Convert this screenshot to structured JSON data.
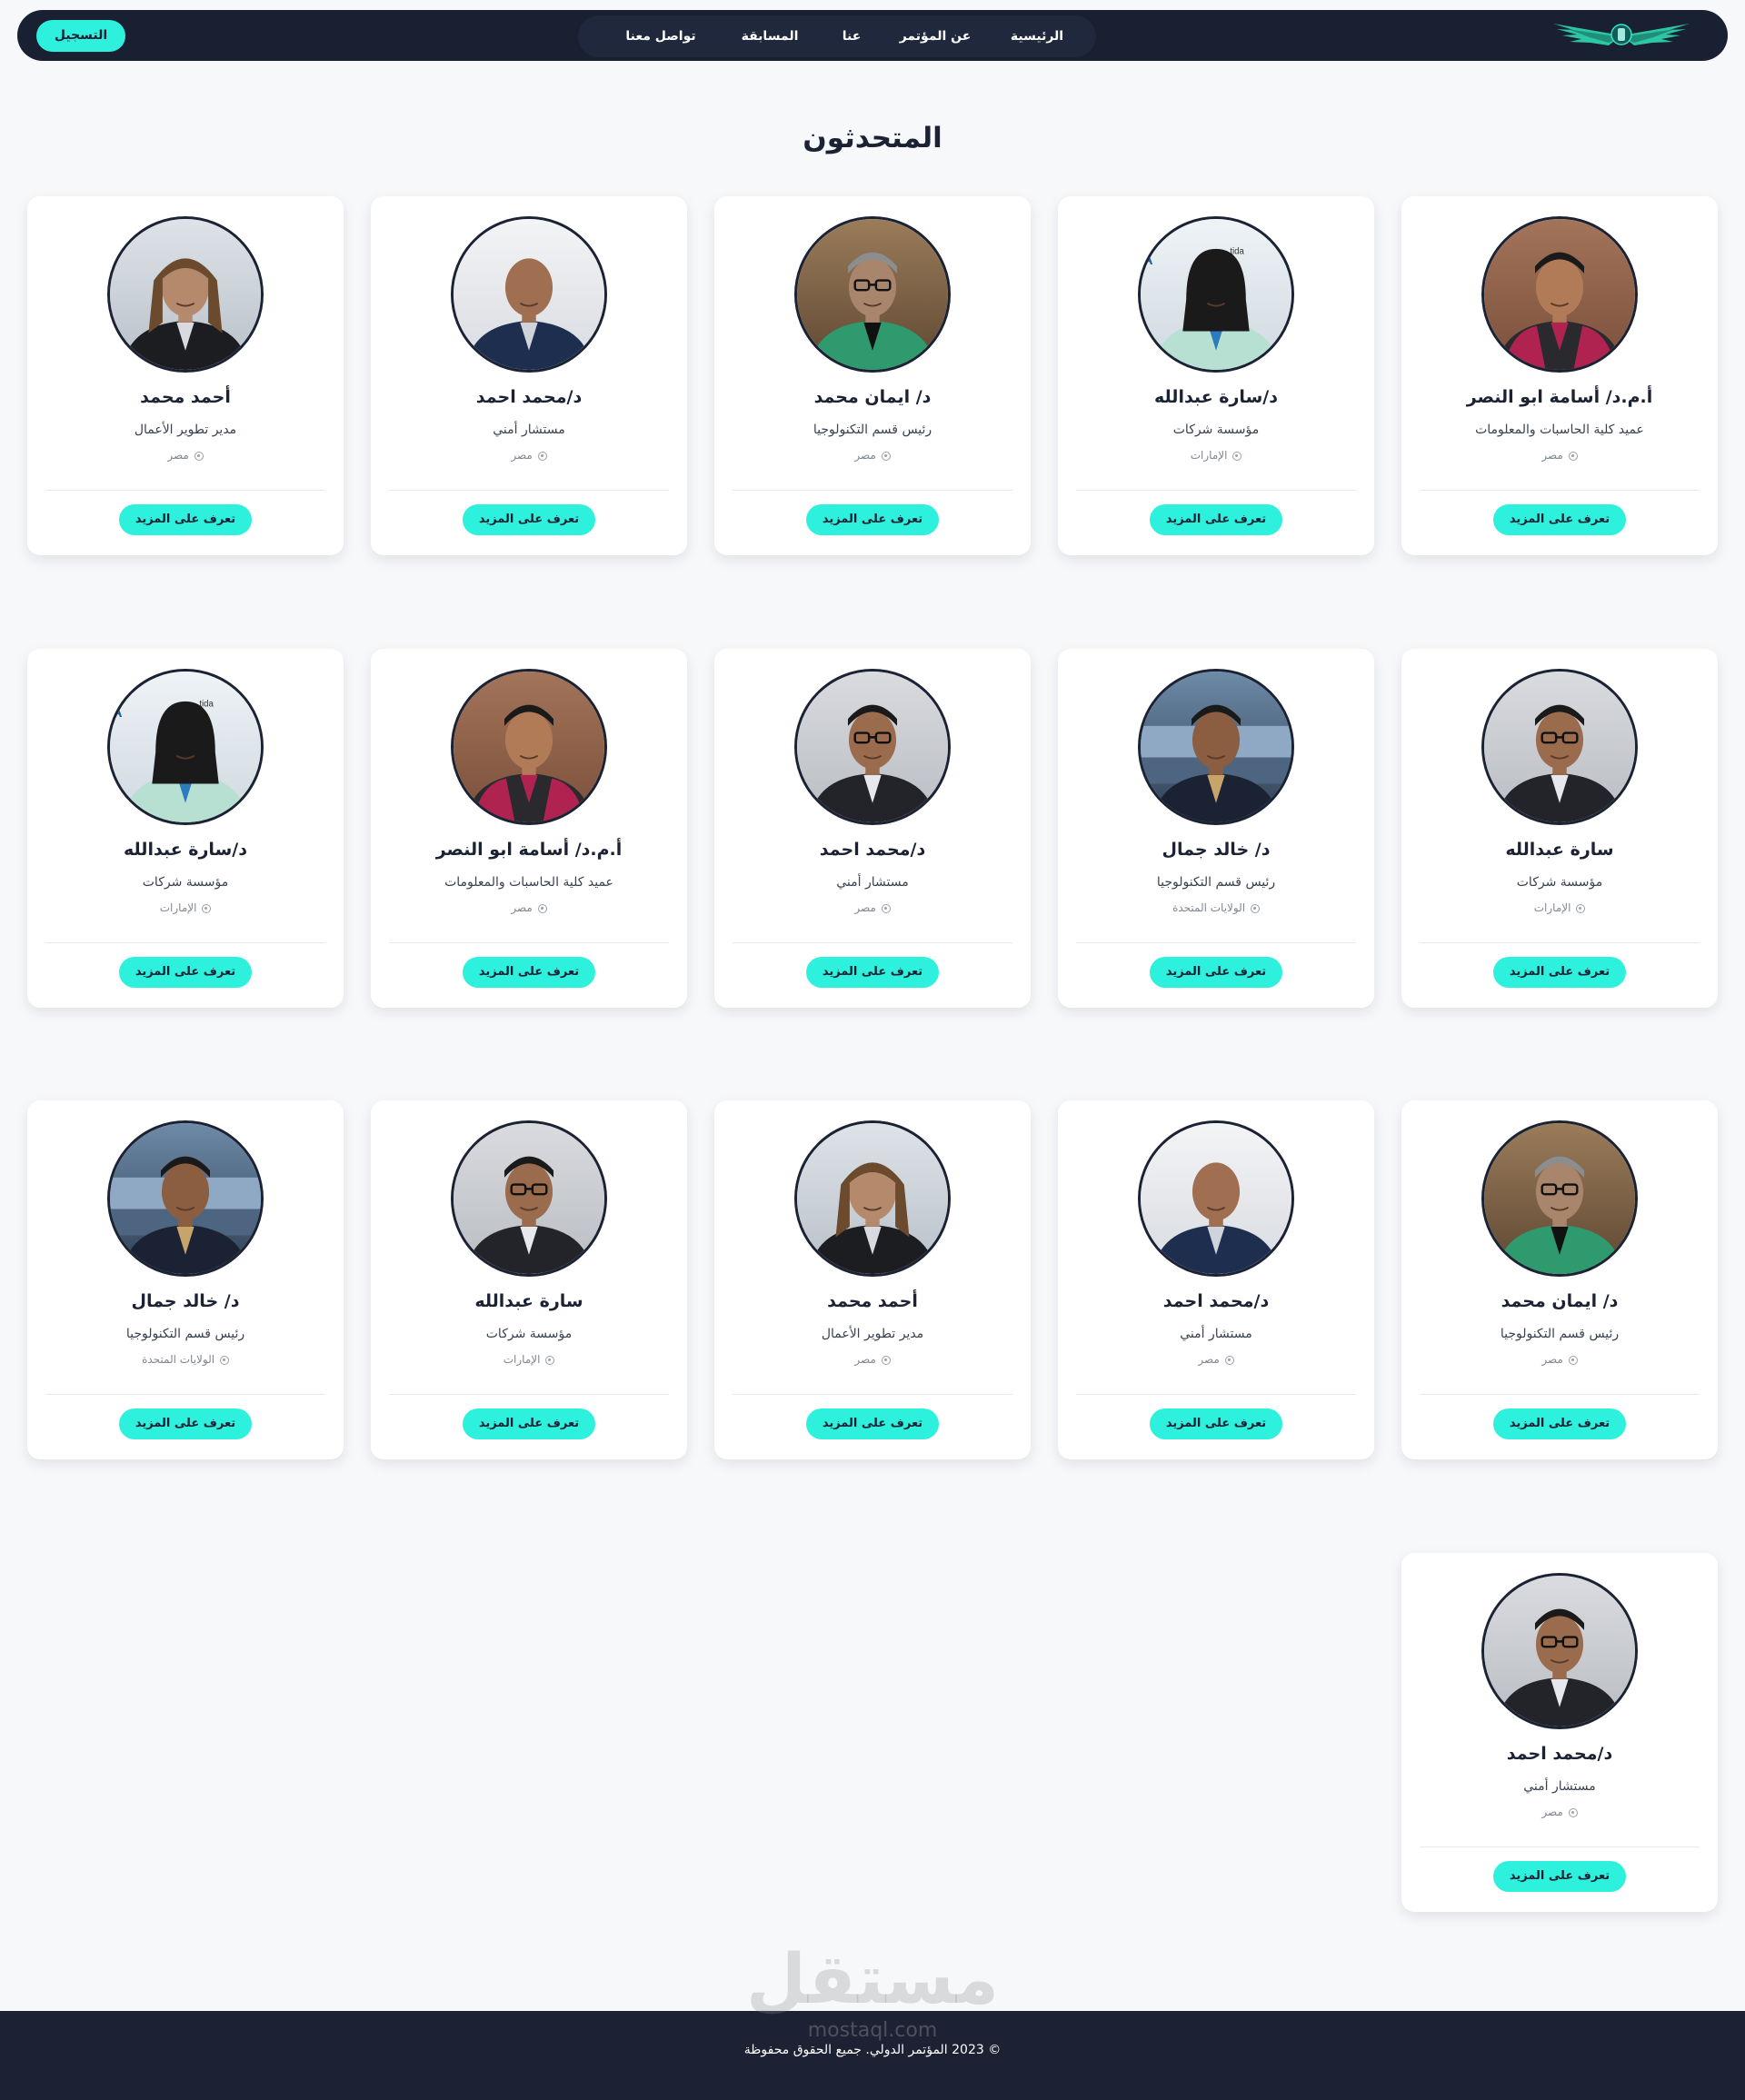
{
  "nav": {
    "links": [
      "الرئيسية",
      "عن المؤتمر",
      "عنا",
      "المسابقة",
      "تواصل معنا"
    ],
    "register_label": "التسجيل"
  },
  "page_title": "المتحدثون",
  "more_label": "تعرف على المزيد",
  "speakers": [
    {
      "name": "أ.م.د/ أسامة ابو النصر",
      "role": "عميد كلية الحاسبات والمعلومات",
      "country": "مصر",
      "photo": "gown"
    },
    {
      "name": "د/سارة عبدالله",
      "role": "مؤسسة شركات",
      "country": "الإمارات",
      "photo": "hijab-mint"
    },
    {
      "name": "د/ ايمان محمد",
      "role": "رئيس قسم التكنولوجيا",
      "country": "مصر",
      "photo": "glasses-green"
    },
    {
      "name": "د/محمد احمد",
      "role": "مستشار أمني",
      "country": "مصر",
      "photo": "bald-suit"
    },
    {
      "name": "أحمد محمد",
      "role": "مدير تطوير الأعمال",
      "country": "مصر",
      "photo": "long-hair"
    },
    {
      "name": "سارة عبدالله",
      "role": "مؤسسة شركات",
      "country": "الإمارات",
      "photo": "glasses-suit"
    },
    {
      "name": "د/ خالد جمال",
      "role": "رئيس قسم التكنولوجيا",
      "country": "الولايات المتحدة",
      "photo": "river"
    },
    {
      "name": "د/محمد احمد",
      "role": "مستشار أمني",
      "country": "مصر",
      "photo": "glasses-suit"
    },
    {
      "name": "أ.م.د/ أسامة ابو النصر",
      "role": "عميد كلية الحاسبات والمعلومات",
      "country": "مصر",
      "photo": "gown"
    },
    {
      "name": "د/سارة عبدالله",
      "role": "مؤسسة شركات",
      "country": "الإمارات",
      "photo": "hijab-mint"
    },
    {
      "name": "د/ ايمان محمد",
      "role": "رئيس قسم التكنولوجيا",
      "country": "مصر",
      "photo": "glasses-green"
    },
    {
      "name": "د/محمد احمد",
      "role": "مستشار أمني",
      "country": "مصر",
      "photo": "bald-suit"
    },
    {
      "name": "أحمد محمد",
      "role": "مدير تطوير الأعمال",
      "country": "مصر",
      "photo": "long-hair"
    },
    {
      "name": "سارة عبدالله",
      "role": "مؤسسة شركات",
      "country": "الإمارات",
      "photo": "glasses-suit"
    },
    {
      "name": "د/ خالد جمال",
      "role": "رئيس قسم التكنولوجيا",
      "country": "الولايات المتحدة",
      "photo": "river"
    },
    {
      "name": "د/محمد احمد",
      "role": "مستشار أمني",
      "country": "مصر",
      "photo": "glasses-suit"
    }
  ],
  "footer": {
    "copyright": "© 2023 المؤتمر الدولي. جميع الحقوق محفوظة",
    "watermark": "مستقل",
    "watermark_sub": "mostaql.com"
  }
}
